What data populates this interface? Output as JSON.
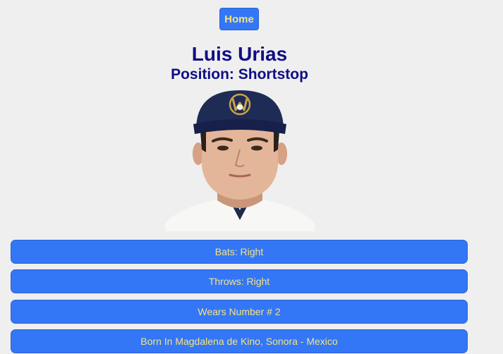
{
  "nav": {
    "home_label": "Home"
  },
  "player": {
    "name": "Luis Urias",
    "position": "Position: Shortstop"
  },
  "photo": {
    "subject": "player-headshot"
  },
  "details": [
    {
      "label": "Bats: Right"
    },
    {
      "label": "Throws: Right"
    },
    {
      "label": "Wears Number # 2"
    },
    {
      "label": "Born In Magdalena de Kino, Sonora - Mexico"
    }
  ],
  "colors": {
    "background": "#efefef",
    "button": "#3477f6",
    "button_text": "#f6e27f",
    "heading": "#0e0e85"
  }
}
